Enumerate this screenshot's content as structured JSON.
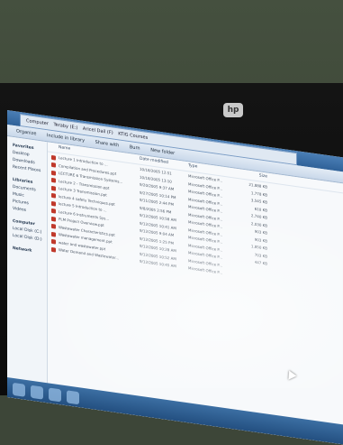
{
  "brand": {
    "logo_text": "hp"
  },
  "explorer": {
    "breadcrumbs": [
      "Computer",
      "Teraby (E:)",
      "Aricel Dail (F)",
      "KTIG Courses"
    ],
    "toolbar": [
      "Organize",
      "Include in library",
      "Share with",
      "Burn",
      "New folder"
    ],
    "nav": [
      "Favorites",
      "Desktop",
      "Downloads",
      "Recent Places",
      "Libraries",
      "Documents",
      "Music",
      "Pictures",
      "Videos",
      "Computer",
      "Local Disk (C:)",
      "Local Disk (D:)",
      "Network"
    ],
    "columns": {
      "name": "Name",
      "date": "Date modified",
      "type": "Type",
      "size": "Size"
    },
    "rows": [
      {
        "name": "Lecture 1 Introduction to ...",
        "date": "10/18/2005 12:51",
        "type": "Microsoft Office P...",
        "size": "21,888 KB"
      },
      {
        "name": "Compilation and Procedures.ppt",
        "date": "10/18/2005 13:10",
        "type": "Microsoft Office P...",
        "size": "1,778 KB"
      },
      {
        "name": "LECTURE 6 Transmission Systems...",
        "date": "9/20/2005 9:37 AM",
        "type": "Microsoft Office P...",
        "size": "3,545 KB"
      },
      {
        "name": "Lecture 2 - Transmission.ppt",
        "date": "9/27/2005 10:14 PM",
        "type": "Microsoft Office P...",
        "size": "610 KB"
      },
      {
        "name": "Lecture 3 Transmission.ppt",
        "date": "9/11/2005 2:44 PM",
        "type": "Microsoft Office P...",
        "size": "2,740 KB"
      },
      {
        "name": "lecture 4 safety Techniques.ppt",
        "date": "9/8/2005 2:56 PM",
        "type": "Microsoft Office P...",
        "size": "2,030 KB"
      },
      {
        "name": "lecture 5 Introduction to ...",
        "date": "9/12/2005 10:58 AM",
        "type": "Microsoft Office P...",
        "size": "903 KB"
      },
      {
        "name": "Lecture 6 Instruments Sys...",
        "date": "9/12/2005 10:41 AM",
        "type": "Microsoft Office P...",
        "size": "903 KB"
      },
      {
        "name": "PLM Project Overview.ppt",
        "date": "9/12/2005 9:04 AM",
        "type": "Microsoft Office P...",
        "size": "1,850 KB"
      },
      {
        "name": "Wastewater Characteristics.ppt",
        "date": "9/12/2005 1:25 PM",
        "type": "Microsoft Office P...",
        "size": "703 KB"
      },
      {
        "name": "Wastewater management.ppt",
        "date": "9/12/2005 10:28 AM",
        "type": "Microsoft Office P...",
        "size": "447 KB"
      },
      {
        "name": "water and wastewater.ppt",
        "date": "9/12/2005 10:52 AM",
        "type": "Microsoft Office P...",
        "size": ""
      },
      {
        "name": "Water Demand and Wastewater...",
        "date": "9/12/2005 10:45 AM",
        "type": "Microsoft Office P...",
        "size": ""
      }
    ]
  }
}
